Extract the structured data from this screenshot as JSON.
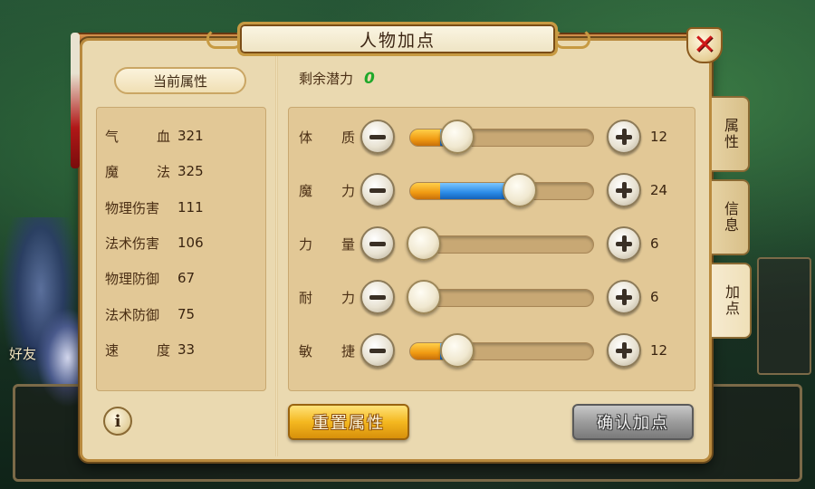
{
  "window": {
    "title": "人物加点",
    "close_icon": "close-icon"
  },
  "left_panel": {
    "tab_label": "当前属性",
    "stats": [
      {
        "label_chars": [
          "气",
          "血"
        ],
        "value": "321"
      },
      {
        "label_chars": [
          "魔",
          "法"
        ],
        "value": "325"
      },
      {
        "label": "物理伤害",
        "value": "111"
      },
      {
        "label": "法术伤害",
        "value": "106"
      },
      {
        "label": "物理防御",
        "value": "67"
      },
      {
        "label": "法术防御",
        "value": "75"
      },
      {
        "label_chars": [
          "速",
          "度"
        ],
        "value": "33"
      }
    ],
    "info_button": "i"
  },
  "right_panel": {
    "remaining_label": "剩余潜力",
    "remaining_value": "0",
    "attributes": [
      {
        "chars": [
          "体",
          "质"
        ],
        "value": "12",
        "base_fraction": 0.16,
        "added_fraction": 0.0,
        "level_fraction": 0.26
      },
      {
        "chars": [
          "魔",
          "力"
        ],
        "value": "24",
        "base_fraction": 0.16,
        "added_fraction": 0.0,
        "level_fraction": 0.6
      },
      {
        "chars": [
          "力",
          "量"
        ],
        "value": "6",
        "base_fraction": 0.08,
        "added_fraction": 0.0,
        "level_fraction": 0.08
      },
      {
        "chars": [
          "耐",
          "力"
        ],
        "value": "6",
        "base_fraction": 0.08,
        "added_fraction": 0.0,
        "level_fraction": 0.08
      },
      {
        "chars": [
          "敏",
          "捷"
        ],
        "value": "12",
        "base_fraction": 0.16,
        "added_fraction": 0.0,
        "level_fraction": 0.26
      }
    ],
    "reset_label": "重置属性",
    "confirm_label": "确认加点"
  },
  "side_tabs": [
    {
      "label": "属性",
      "active": false
    },
    {
      "label": "信息",
      "active": false
    },
    {
      "label": "加点",
      "active": true
    }
  ],
  "background": {
    "friend_label": "好友"
  },
  "colors": {
    "accent_orange": "#f09a12",
    "accent_blue": "#2a8ae6",
    "remaining_green": "#1fa82a",
    "close_red": "#d01818"
  }
}
